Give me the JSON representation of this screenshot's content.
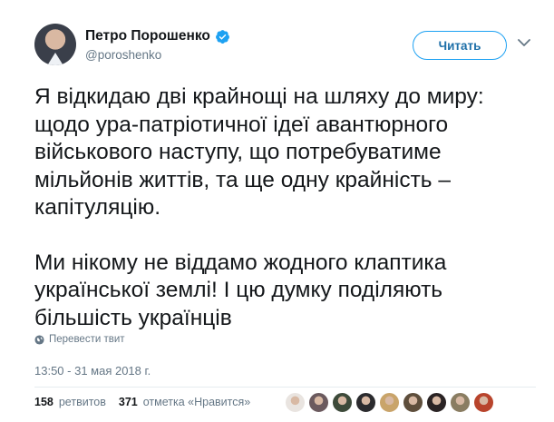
{
  "author": {
    "name": "Петро Порошенко",
    "handle": "@poroshenko"
  },
  "follow_button": {
    "label": "Читать"
  },
  "icons": {
    "verified": "verified-badge-icon",
    "caret": "chevron-down-icon",
    "globe": "globe-icon"
  },
  "tweet": {
    "paragraphs": [
      "Я відкидаю дві крайнощі на шляху до миру:\nщодо ура-патріотичної ідеї авантюрного\nвійськового наступу, що потребуватиме\nмільйонів життів, та ще одну крайність –\nкапітуляцію.",
      "Ми нікому не віддамо жодного клаптика\nукраїнської землі! І цю думку поділяють\nбільшість українців"
    ],
    "translate_label": "Перевести твит",
    "timestamp": "13:50 - 31 мая 2018 г."
  },
  "stats": {
    "retweets_count": "158",
    "retweets_label": "ретвитов",
    "likes_count": "371",
    "likes_label": "отметка «Нравится»"
  },
  "likers": {
    "count_shown": 9,
    "colors": [
      "#e9e4e0",
      "#6b5a5e",
      "#3d4a3a",
      "#2b2b2e",
      "#c9a46a",
      "#5e4e3c",
      "#2a2324",
      "#8a7d62",
      "#b8442c"
    ]
  },
  "colors": {
    "accent": "#1da1f2",
    "text": "#14171a",
    "muted": "#657786"
  }
}
